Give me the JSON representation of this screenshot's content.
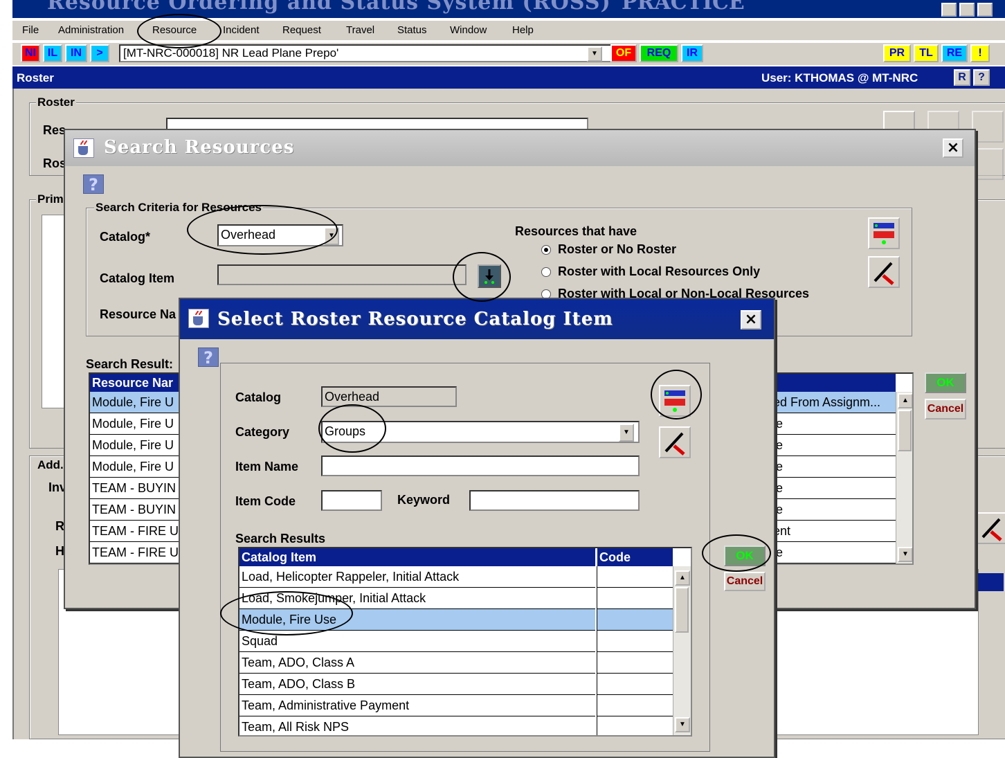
{
  "app": {
    "title": "Resource Ordering and Status System (ROSS)",
    "mode": "PRACTICE"
  },
  "menu": [
    "File",
    "Administration",
    "Resource",
    "Incident",
    "Request",
    "Travel",
    "Status",
    "Window",
    "Help"
  ],
  "toolbar": {
    "left_buttons": [
      {
        "label": "NI",
        "bg": "#ff0000",
        "fg": "#0000ff"
      },
      {
        "label": "IL",
        "bg": "#00c8ff",
        "fg": "#0000ff"
      },
      {
        "label": "IN",
        "bg": "#00c8ff",
        "fg": "#0000ff"
      },
      {
        "label": ">",
        "bg": "#00c8ff",
        "fg": "#0000ff"
      }
    ],
    "incident_value": "[MT-NRC-000018] NR Lead Plane Prepo'",
    "mid_buttons": [
      {
        "label": "OF",
        "bg": "#ff0000",
        "fg": "#ffff00"
      },
      {
        "label": "REQ",
        "bg": "#00e000",
        "fg": "#0000ff"
      },
      {
        "label": "IR",
        "bg": "#00c8ff",
        "fg": "#0000ff"
      }
    ],
    "right_buttons": [
      {
        "label": "PR",
        "bg": "#ffff00",
        "fg": "#0000ff"
      },
      {
        "label": "TL",
        "bg": "#ffff00",
        "fg": "#0000ff"
      },
      {
        "label": "RE",
        "bg": "#00c8ff",
        "fg": "#0000ff"
      },
      {
        "label": "!",
        "bg": "#ffff00",
        "fg": "#0000ff"
      }
    ]
  },
  "roster_header": {
    "title": "Roster",
    "user": "User: KTHOMAS @ MT-NRC",
    "btn_r": "R",
    "btn_help": "?"
  },
  "roster_panel": {
    "group_label": "Roster",
    "row1_label": "Res",
    "row2_label": "Ros",
    "primary_label": "Prim",
    "add_label": "Add.",
    "inv_label": "Inv",
    "r_label": "R",
    "h_label": "H"
  },
  "search_dialog": {
    "title": "Search Resources",
    "criteria_label": "Search Criteria for Resources",
    "catalog_label": "Catalog*",
    "catalog_value": "Overhead",
    "catalog_item_label": "Catalog Item",
    "resource_name_label": "Resource Na",
    "resources_that_have": "Resources that have",
    "radio_options": [
      {
        "label": "Roster or No Roster",
        "selected": true
      },
      {
        "label": "Roster with Local Resources Only",
        "selected": false
      },
      {
        "label": "Roster with Local or Non-Local Resources",
        "selected": false
      }
    ],
    "results_label": "Search Result:",
    "col_resource_name": "Resource Nar",
    "rows_left": [
      "Module, Fire U",
      "Module, Fire U",
      "Module, Fire U",
      "Module, Fire U",
      "TEAM - BUYIN",
      "TEAM - BUYIN",
      "TEAM - FIRE U",
      "TEAM - FIRE U"
    ],
    "rows_right": [
      "ed From Assignm...",
      "le",
      "le",
      "le",
      "le",
      "le",
      "ent",
      "le"
    ],
    "ok": "OK",
    "cancel": "Cancel"
  },
  "select_dialog": {
    "title": "Select Roster Resource Catalog Item",
    "catalog_label": "Catalog",
    "catalog_value": "Overhead",
    "category_label": "Category",
    "category_value": "Groups",
    "item_name_label": "Item Name",
    "item_code_label": "Item Code",
    "keyword_label": "Keyword",
    "results_label": "Search Results",
    "col_catalog_item": "Catalog Item",
    "col_code": "Code",
    "rows": [
      "Load, Helicopter Rappeler, Initial Attack",
      "Load, Smokejumper, Initial Attack",
      "Module, Fire Use",
      "Squad",
      "Team, ADO, Class A",
      "Team, ADO, Class B",
      "Team, Administrative Payment",
      "Team, All Risk NPS"
    ],
    "selected_index": 2,
    "ok": "OK",
    "cancel": "Cancel"
  },
  "colors": {
    "dialog_bg": "#d4d0c8",
    "header_blue": "#0a1f8e",
    "selection": "#a6caf0",
    "ok_green": "#00ff00"
  }
}
